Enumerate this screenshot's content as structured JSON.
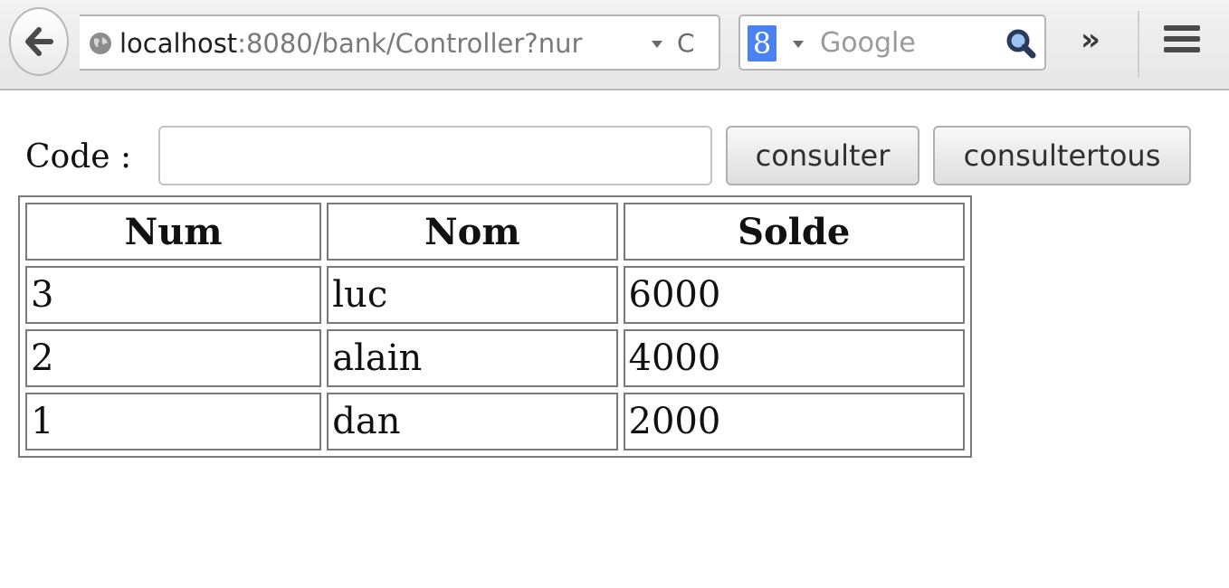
{
  "browser": {
    "url_host": "localhost",
    "url_rest": ":8080/bank/Controller?nur",
    "search_engine_icon": "google-g-icon",
    "search_placeholder": "Google",
    "icons": {
      "back": "back-arrow-icon",
      "site": "globe-icon",
      "reload": "reload-icon",
      "search": "magnifier-icon",
      "overflow": "chevron-double-right-icon",
      "menu": "hamburger-menu-icon"
    }
  },
  "form": {
    "code_label": "Code :",
    "code_value": "",
    "consulter_label": "consulter",
    "consultertous_label": "consultertous"
  },
  "table": {
    "headers": [
      "Num",
      "Nom",
      "Solde"
    ],
    "rows": [
      [
        "3",
        "luc",
        "6000"
      ],
      [
        "2",
        "alain",
        "4000"
      ],
      [
        "1",
        "dan",
        "2000"
      ]
    ]
  }
}
